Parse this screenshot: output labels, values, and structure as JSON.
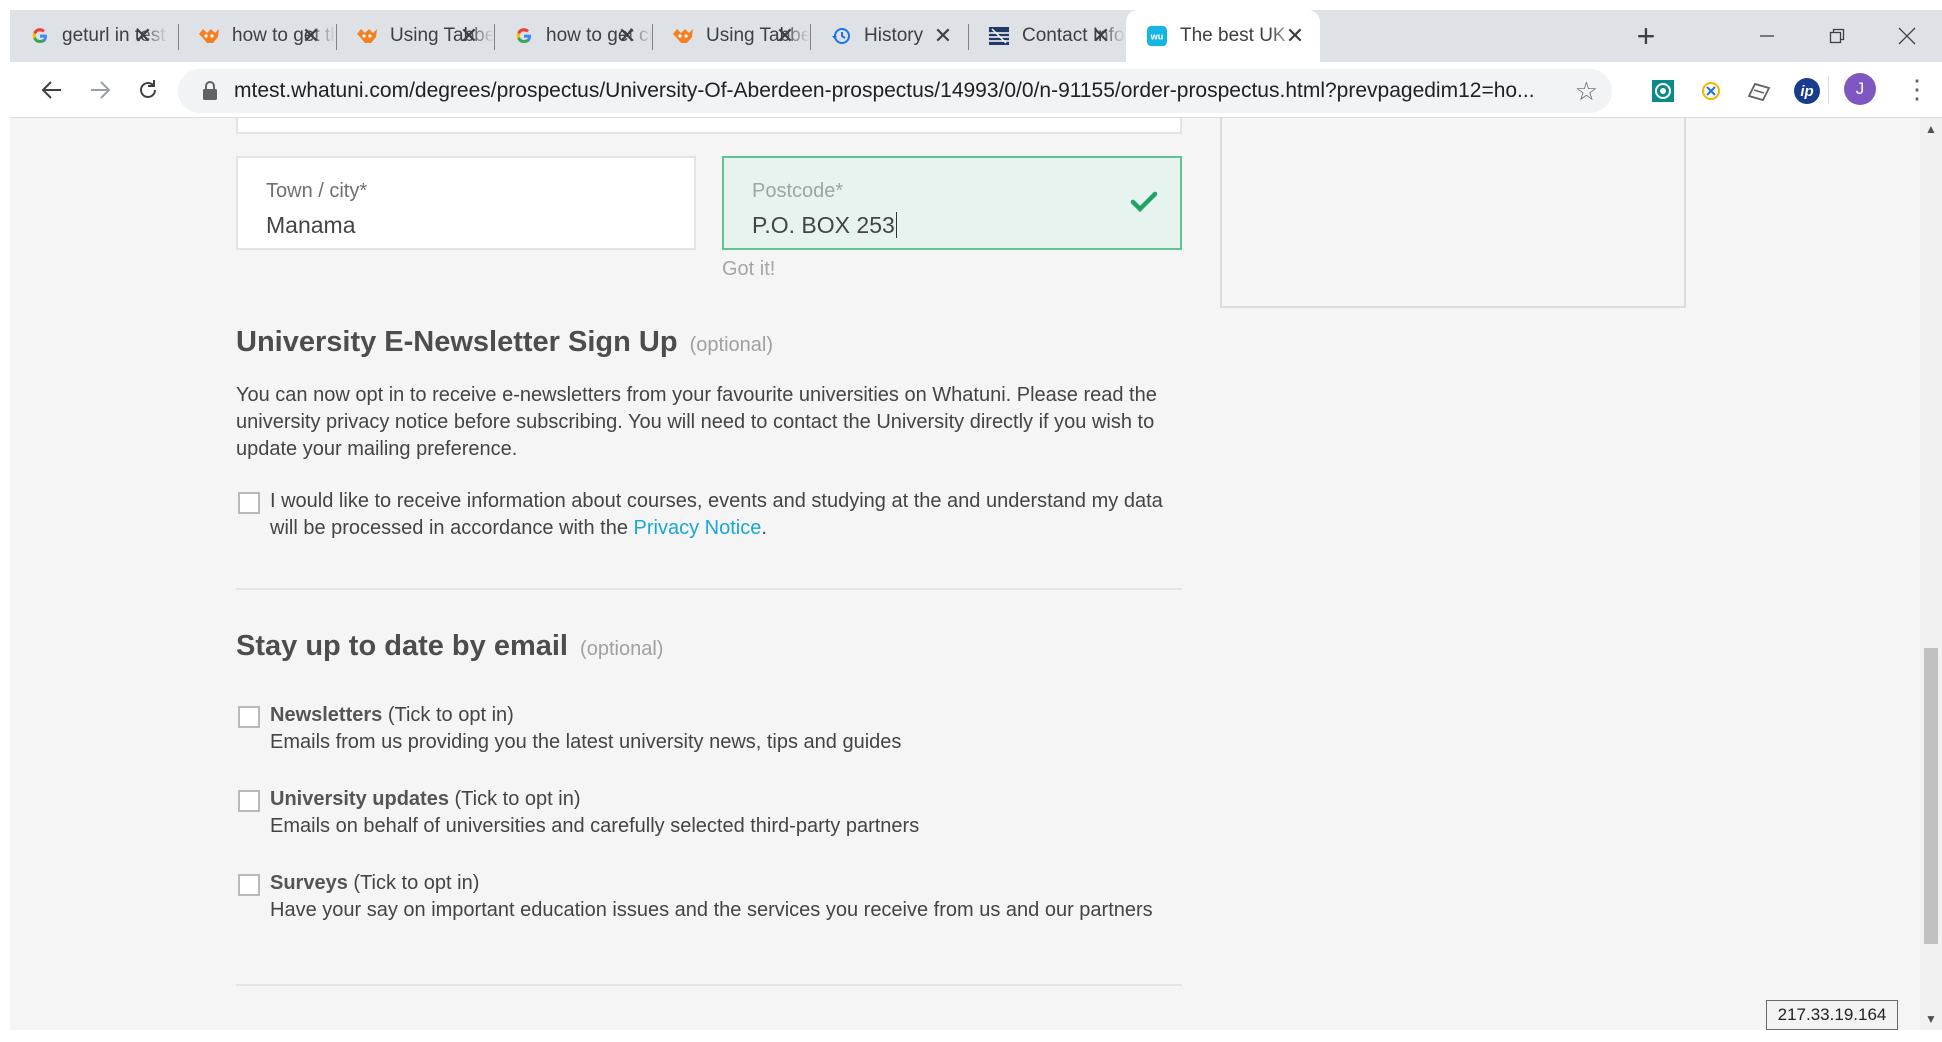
{
  "browser": {
    "tabs": [
      {
        "title": "geturl in test",
        "icon": "google-icon"
      },
      {
        "title": "how to get the",
        "icon": "stackoverflow-icon"
      },
      {
        "title": "Using Tabbed",
        "icon": "stackoverflow-icon"
      },
      {
        "title": "how to get cu",
        "icon": "google-icon"
      },
      {
        "title": "Using Tabbed",
        "icon": "stackoverflow-icon"
      },
      {
        "title": "History",
        "icon": "history-icon"
      },
      {
        "title": "Contact Info",
        "icon": "contact-icon"
      },
      {
        "title": "The best UK",
        "icon": "whatuni-icon",
        "active": true
      }
    ],
    "new_tab": "+",
    "url": "mtest.whatuni.com/degrees/prospectus/University-Of-Aberdeen-prospectus/14993/0/0/n-91155/order-prospectus.html?prevpagedim12=ho...",
    "profile_initial": "J",
    "extensions": [
      "extension-icon",
      "extension-icon",
      "extension-icon",
      "extension-icon"
    ],
    "extension_ip_label": "ip"
  },
  "form": {
    "town": {
      "label": "Town / city*",
      "value": "Manama"
    },
    "postcode": {
      "label": "Postcode*",
      "value": "P.O. BOX 253",
      "status": "valid"
    },
    "postcode_hint": "Got it!"
  },
  "newsletter": {
    "heading": "University E-Newsletter Sign Up",
    "optional": "(optional)",
    "description": "You can now opt in to receive e-newsletters from your favourite universities on Whatuni. Please read the university privacy notice before subscribing. You will need to contact the University directly if you wish to update your mailing preference.",
    "consent_text": "I would like to receive information about courses, events and studying at the and understand my data will be processed in accordance with the",
    "privacy_link": "Privacy Notice",
    "consent_end": "."
  },
  "email_prefs": {
    "heading": "Stay up to date by email",
    "optional": "(optional)",
    "options": [
      {
        "title": "Newsletters",
        "suffix": "(Tick to opt in)",
        "desc": "Emails from us providing you the latest university news, tips and guides"
      },
      {
        "title": "University updates",
        "suffix": "(Tick to opt in)",
        "desc": "Emails on behalf of universities and carefully selected third-party partners"
      },
      {
        "title": "Surveys",
        "suffix": "(Tick to opt in)",
        "desc": "Have your say on important education issues and the services you receive from us and our partners"
      }
    ]
  },
  "ip_address": "217.33.19.164",
  "colors": {
    "valid_green": "#5fc394",
    "link_blue": "#18a7d8",
    "profile_purple": "#7e57c2"
  }
}
